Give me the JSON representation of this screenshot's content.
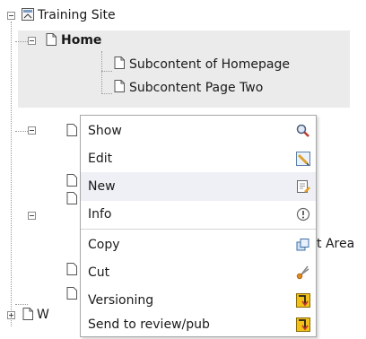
{
  "tree": {
    "root_label": "Training Site",
    "home_label": "Home",
    "sub1_label": "Subcontent of Homepage",
    "sub2_label": "Subcontent Page Two",
    "partial_area_label": "t Area",
    "partial_w_label": "W"
  },
  "context_menu": {
    "items": [
      {
        "label": "Show",
        "icon": "magnifier-icon"
      },
      {
        "label": "Edit",
        "icon": "pencil-icon"
      },
      {
        "label": "New",
        "icon": "new-page-icon"
      },
      {
        "label": "Info",
        "icon": "info-icon"
      },
      {
        "label": "Copy",
        "icon": "copy-icon"
      },
      {
        "label": "Cut",
        "icon": "scissors-icon"
      },
      {
        "label": "Versioning",
        "icon": "versioning-icon"
      },
      {
        "label": "Send to review/pub",
        "icon": "send-review-icon"
      }
    ],
    "active_item": "New"
  },
  "colors": {
    "highlight": "#ebebeb",
    "menu_active": "#eef0f5",
    "text": "#1a1a1a"
  }
}
